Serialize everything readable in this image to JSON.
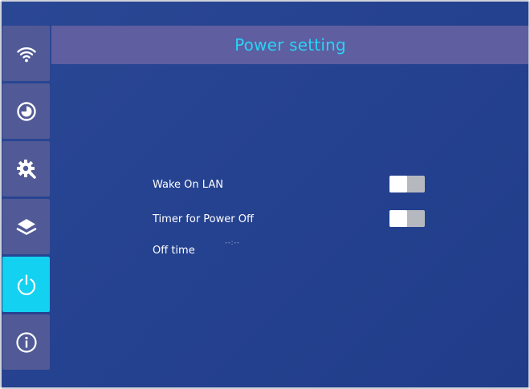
{
  "header": {
    "title": "Power setting"
  },
  "sidebar": {
    "items": [
      {
        "name": "wifi",
        "icon": "wifi-icon",
        "active": false
      },
      {
        "name": "time",
        "icon": "clock-pie-icon",
        "active": false
      },
      {
        "name": "settings",
        "icon": "gear-wrench-icon",
        "active": false
      },
      {
        "name": "layers",
        "icon": "layers-icon",
        "active": false
      },
      {
        "name": "power",
        "icon": "power-icon",
        "active": true
      },
      {
        "name": "info",
        "icon": "info-icon",
        "active": false
      }
    ]
  },
  "settings": {
    "wake_on_lan": {
      "label": "Wake On LAN",
      "enabled": false
    },
    "timer_power_off": {
      "label": "Timer for Power Off",
      "enabled": false
    },
    "off_time": {
      "label": "Off time",
      "value": "--:--"
    }
  },
  "colors": {
    "background": "#24418f",
    "sidebar_item": "#515a96",
    "active_item": "#12d1f1",
    "header_bar": "#5e5ea1",
    "title_text": "#29d3f5"
  }
}
